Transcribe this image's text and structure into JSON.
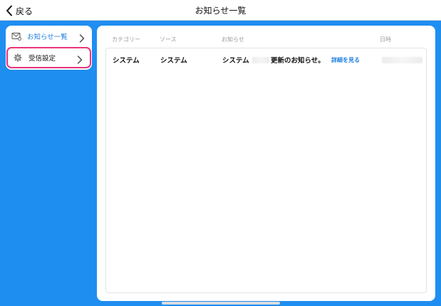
{
  "header": {
    "back_label": "戻る",
    "title": "お知らせ一覧"
  },
  "sidebar": {
    "items": [
      {
        "label": "お知らせ一覧",
        "icon": "mail-icon",
        "selected": true
      },
      {
        "label": "受信設定",
        "icon": "gear-icon",
        "highlighted": true
      }
    ]
  },
  "table": {
    "columns": [
      "カテゴリー",
      "ソース",
      "お知らせ",
      "日時"
    ],
    "rows": [
      {
        "category": "システム",
        "source": "システム",
        "notice_prefix": "システム",
        "notice_text": "更新のお知らせ。",
        "detail_link": "詳細を見る"
      }
    ]
  },
  "colors": {
    "background": "#1f8ef1",
    "accent": "#1f7fe0",
    "highlight_border": "#e9347b"
  }
}
